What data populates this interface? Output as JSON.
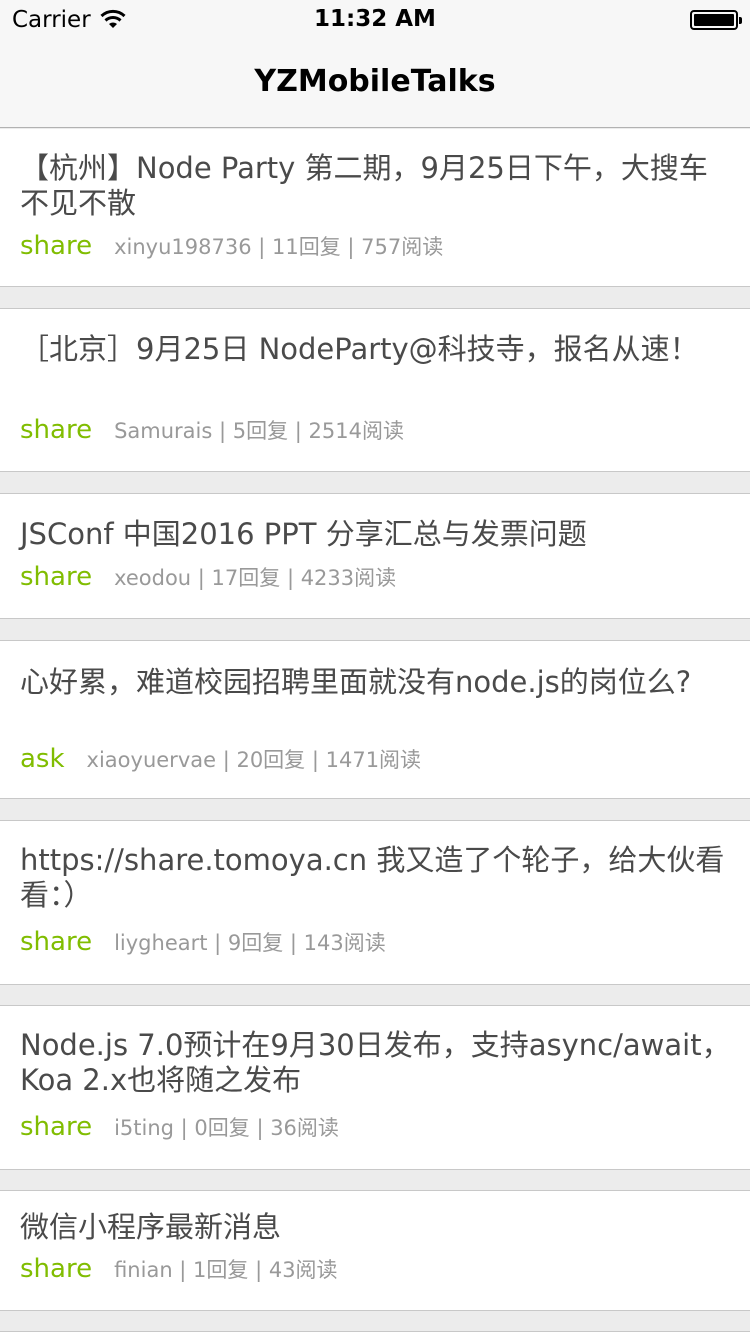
{
  "status_bar": {
    "carrier": "Carrier",
    "time": "11:32 AM",
    "wifi_icon": "wifi-icon",
    "battery_icon": "battery-icon"
  },
  "nav": {
    "title": "YZMobileTalks"
  },
  "topics": [
    {
      "title": "【杭州】Node Party 第二期，9月25日下午，大搜车不见不散",
      "tag": "share",
      "author": "xinyu198736",
      "replies": "11回复",
      "reads": "757阅读",
      "info": "xinyu198736 | 11回复 | 757阅读"
    },
    {
      "title": "［北京］9月25日 NodeParty@科技寺，报名从速！",
      "tag": "share",
      "author": "Samurais",
      "replies": "5回复",
      "reads": "2514阅读",
      "info": "Samurais | 5回复 | 2514阅读"
    },
    {
      "title": "JSConf 中国2016 PPT 分享汇总与发票问题",
      "tag": "share",
      "author": "xeodou",
      "replies": "17回复",
      "reads": "4233阅读",
      "info": "xeodou | 17回复 | 4233阅读"
    },
    {
      "title": "心好累，难道校园招聘里面就没有node.js的岗位么?",
      "tag": "ask",
      "author": "xiaoyuervae",
      "replies": "20回复",
      "reads": "1471阅读",
      "info": "xiaoyuervae | 20回复 | 1471阅读"
    },
    {
      "title": "https://share.tomoya.cn 我又造了个轮子，给大伙看看：）",
      "tag": "share",
      "author": "liygheart",
      "replies": "9回复",
      "reads": "143阅读",
      "info": "liygheart | 9回复 | 143阅读"
    },
    {
      "title": "Node.js 7.0预计在9月30日发布，支持async/await，Koa 2.x也将随之发布",
      "tag": "share",
      "author": "i5ting",
      "replies": "0回复",
      "reads": "36阅读",
      "info": "i5ting | 0回复 | 36阅读"
    },
    {
      "title": "微信小程序最新消息",
      "tag": "share",
      "author": "finian",
      "replies": "1回复",
      "reads": "43阅读",
      "info": "finian | 1回复 | 43阅读"
    }
  ],
  "colors": {
    "tag": "#80bd01",
    "title_text": "#4a4a4a",
    "meta_text": "#999999",
    "separator": "#ececec",
    "nav_background": "#f7f7f7"
  }
}
